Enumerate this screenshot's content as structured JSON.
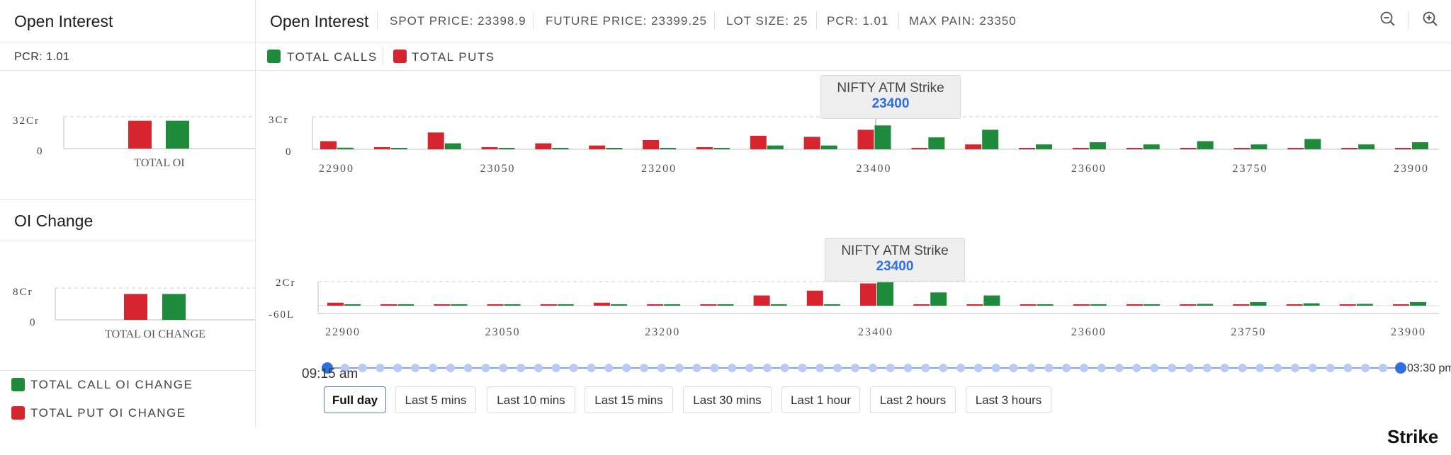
{
  "sidebar": {
    "oi_title": "Open Interest",
    "pcr": "PCR: 1.01",
    "total_oi_label": "TOTAL OI",
    "oi_change_title": "OI Change",
    "total_oi_change_label": "TOTAL OI CHANGE",
    "legend_call_change": "TOTAL CALL OI CHANGE",
    "legend_put_change": "TOTAL PUT OI CHANGE"
  },
  "header": {
    "title": "Open Interest",
    "spot": "SPOT PRICE: 23398.9",
    "future": "FUTURE PRICE: 23399.25",
    "lot": "LOT SIZE: 25",
    "pcr": "PCR: 1.01",
    "maxpain": "MAX PAIN: 23350"
  },
  "legend": {
    "calls": "TOTAL CALLS",
    "puts": "TOTAL PUTS"
  },
  "atm": {
    "label": "NIFTY ATM Strike",
    "strike": "23400"
  },
  "timeline": {
    "start": "09:15 am",
    "end": "03:30 pm"
  },
  "buttons": [
    "Full day",
    "Last 5 mins",
    "Last 10 mins",
    "Last 15 mins",
    "Last 30 mins",
    "Last 1 hour",
    "Last 2 hours",
    "Last 3 hours"
  ],
  "brand": "Strike",
  "colors": {
    "calls": "#1e8a3c",
    "puts": "#d6252f",
    "accent": "#2f6fe0"
  },
  "icons": [
    "zoom-out-icon",
    "zoom-in-icon"
  ],
  "chart_data": [
    {
      "type": "bar",
      "name": "total-oi-summary",
      "categories": [
        "TOTAL OI"
      ],
      "series": [
        {
          "values": [
            28
          ]
        },
        {
          "values": [
            28
          ]
        }
      ],
      "yticks": [
        "32Cr",
        "0"
      ],
      "ylim": [
        0,
        32
      ]
    },
    {
      "type": "bar",
      "name": "oi-by-strike",
      "categories": [
        "22900",
        "22950",
        "23000",
        "23050",
        "23100",
        "23150",
        "23200",
        "23250",
        "23300",
        "23350",
        "23400",
        "23450",
        "23500",
        "23550",
        "23600",
        "23650",
        "23700",
        "23750",
        "23800",
        "23850",
        "23900"
      ],
      "tick_labels": [
        "22900",
        "23050",
        "23200",
        "23400",
        "23600",
        "23750",
        "23900"
      ],
      "series": [
        {
          "name": "TOTAL CALLS",
          "values": [
            0.15,
            0.12,
            0.55,
            0.12,
            0.12,
            0.12,
            0.12,
            0.12,
            0.35,
            0.35,
            2.2,
            1.1,
            1.8,
            0.45,
            0.65,
            0.45,
            0.75,
            0.45,
            0.95,
            0.45,
            0.65
          ]
        },
        {
          "name": "TOTAL PUTS",
          "values": [
            0.75,
            0.2,
            1.55,
            0.2,
            0.55,
            0.35,
            0.85,
            0.2,
            1.25,
            1.15,
            1.8,
            0.12,
            0.45,
            0.12,
            0.12,
            0.12,
            0.12,
            0.12,
            0.12,
            0.12,
            0.12
          ]
        }
      ],
      "yticks": [
        "3Cr",
        "0"
      ],
      "ylim": [
        0,
        3
      ]
    },
    {
      "type": "bar",
      "name": "oi-change-summary",
      "categories": [
        "TOTAL OI CHANGE"
      ],
      "series": [
        {
          "values": [
            6.5
          ]
        },
        {
          "values": [
            6.5
          ]
        }
      ],
      "yticks": [
        "8Cr",
        "0"
      ],
      "ylim": [
        0,
        8
      ]
    },
    {
      "type": "bar",
      "name": "oi-change-by-strike",
      "categories": [
        "22900",
        "22950",
        "23000",
        "23050",
        "23100",
        "23150",
        "23200",
        "23250",
        "23300",
        "23350",
        "23400",
        "23450",
        "23500",
        "23550",
        "23600",
        "23650",
        "23700",
        "23750",
        "23800",
        "23850",
        "23900"
      ],
      "tick_labels": [
        "22900",
        "23050",
        "23200",
        "23400",
        "23600",
        "23750",
        "23900"
      ],
      "series": [
        {
          "name": "TOTAL CALL OI CHANGE",
          "values": [
            0.08,
            0.08,
            0.06,
            0.06,
            0.06,
            0.04,
            0.04,
            0.06,
            0.04,
            0.08,
            1.95,
            1.1,
            0.85,
            0.12,
            0.08,
            0.08,
            0.15,
            0.3,
            0.2,
            0.15,
            0.3
          ]
        },
        {
          "name": "TOTAL PUT OI CHANGE",
          "values": [
            0.25,
            0.12,
            0.1,
            0.1,
            0.08,
            0.25,
            0.08,
            0.1,
            0.85,
            1.25,
            1.85,
            0.08,
            0.08,
            0.06,
            0.06,
            0.06,
            0.06,
            0.06,
            0.06,
            0.06,
            0.06
          ]
        }
      ],
      "yticks": [
        "2Cr",
        "-60L"
      ],
      "ylim": [
        -0.6,
        2
      ]
    }
  ]
}
